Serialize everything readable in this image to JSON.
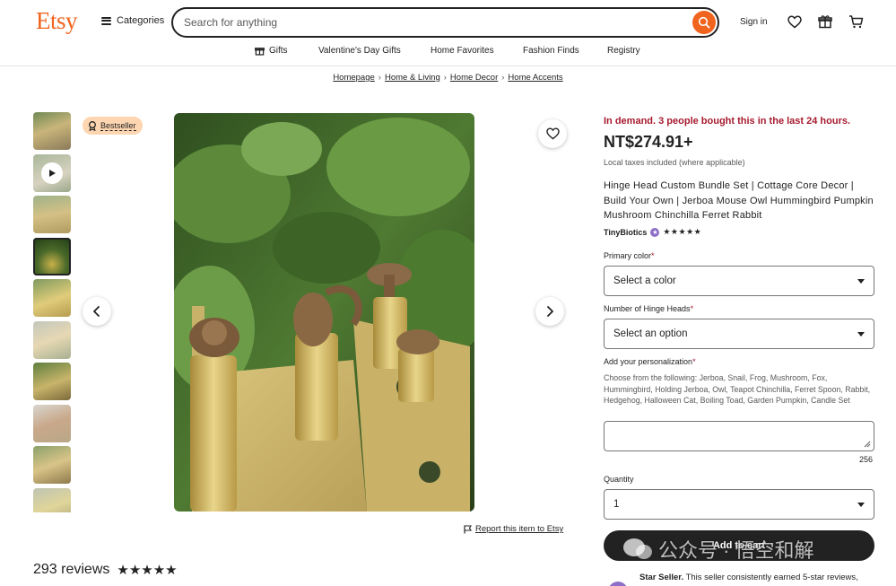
{
  "header": {
    "logo": "Etsy",
    "categories_label": "Categories",
    "search_placeholder": "Search for anything",
    "signin_label": "Sign in"
  },
  "subnav": [
    "Gifts",
    "Valentine's Day Gifts",
    "Home Favorites",
    "Fashion Finds",
    "Registry"
  ],
  "breadcrumb": [
    "Homepage",
    "Home & Living",
    "Home Decor",
    "Home Accents"
  ],
  "gallery": {
    "badge": "Bestseller",
    "report_label": "Report this item to Etsy",
    "active_thumb": 3
  },
  "reviews": {
    "count_label": "293 reviews",
    "stars": "★★★★★"
  },
  "product": {
    "demand": "In demand. 3 people bought this in the last 24 hours.",
    "price": "NT$274.91+",
    "tax_note": "Local taxes included (where applicable)",
    "title": "Hinge Head Custom Bundle Set | Cottage Core Decor | Build Your Own | Jerboa Mouse Owl Hummingbird Pumpkin Mushroom Chinchilla Ferret Rabbit",
    "shop_name": "TinyBiotics",
    "shop_stars": "★★★★★"
  },
  "form": {
    "primary_color_label": "Primary color",
    "primary_color_value": "Select a color",
    "hinge_heads_label": "Number of Hinge Heads",
    "hinge_heads_value": "Select an option",
    "personalization_label": "Add your personalization",
    "personalization_instructions": "Choose from the following: Jerboa, Snail, Frog, Mushroom, Fox, Hummingbird, Holding Jerboa, Owl, Teapot Chinchilla, Ferret Spoon, Rabbit, Hedgehog, Halloween Cat, Boiling Toad, Garden Pumpkin, Candle Set",
    "char_counter": "256",
    "quantity_label": "Quantity",
    "quantity_value": "1",
    "required_mark": "*",
    "add_to_cart": "Add to cart"
  },
  "star_seller": {
    "title": "Star Seller.",
    "text": "This seller consistently earned 5-star reviews,"
  },
  "watermark": "公众号 · 悟空和解",
  "colors": {
    "brand": "#f1641e",
    "demand_red": "#a61a2e",
    "bestseller_bg": "#fdd5b0"
  }
}
